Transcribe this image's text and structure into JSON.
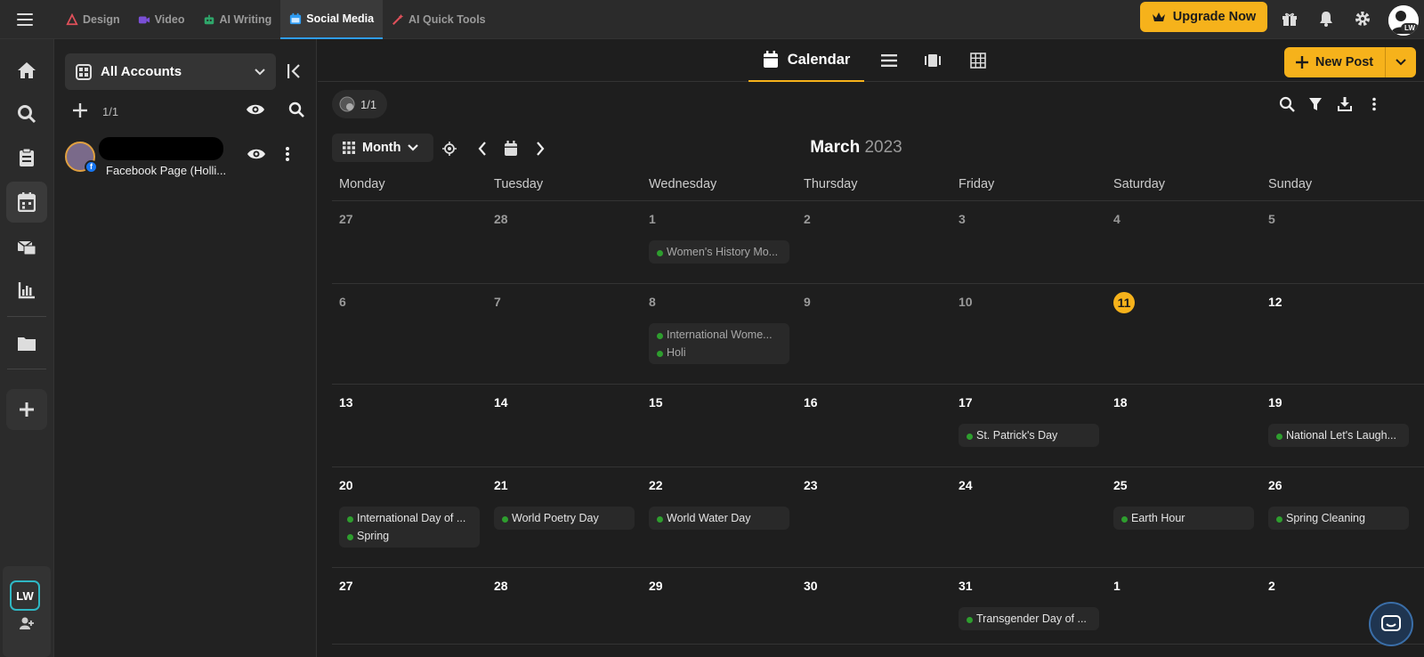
{
  "topbar": {
    "tabs": [
      {
        "label": "Design",
        "icon": "design-icon",
        "color": "#e0505a"
      },
      {
        "label": "Video",
        "icon": "video-icon",
        "color": "#7a4fd6"
      },
      {
        "label": "AI Writing",
        "icon": "robot-icon",
        "color": "#2fa66a"
      },
      {
        "label": "Social Media",
        "icon": "calendar-icon",
        "color": "#2f9df4"
      },
      {
        "label": "AI Quick Tools",
        "icon": "magic-wand-icon",
        "color": "#e0505a"
      }
    ],
    "upgrade_label": "Upgrade Now",
    "avatar_initials": "LW"
  },
  "rail": {
    "items": [
      "home-icon",
      "search-icon",
      "clipboard-icon",
      "calendar-icon",
      "inbox-icon",
      "analytics-icon",
      "folder-icon",
      "plus-icon"
    ],
    "workspace_initials": "LW"
  },
  "accounts": {
    "select_label": "All Accounts",
    "count": "1/1",
    "items": [
      {
        "name": "Facebook Page (Holli..."
      }
    ]
  },
  "main": {
    "view_label": "Calendar",
    "new_post_label": "New Post",
    "pages_count": "1/1",
    "view_mode": "Month",
    "month": "March",
    "year": "2023"
  },
  "calendar": {
    "weekdays": [
      "Monday",
      "Tuesday",
      "Wednesday",
      "Thursday",
      "Friday",
      "Saturday",
      "Sunday"
    ],
    "weeks": [
      [
        {
          "day": "27",
          "dim": true,
          "events": []
        },
        {
          "day": "28",
          "dim": true,
          "events": []
        },
        {
          "day": "1",
          "dim": true,
          "events": [
            "Women's History Mo..."
          ]
        },
        {
          "day": "2",
          "dim": true,
          "events": []
        },
        {
          "day": "3",
          "dim": true,
          "events": []
        },
        {
          "day": "4",
          "dim": true,
          "events": []
        },
        {
          "day": "5",
          "dim": true,
          "events": []
        }
      ],
      [
        {
          "day": "6",
          "dim": true,
          "events": []
        },
        {
          "day": "7",
          "dim": true,
          "events": []
        },
        {
          "day": "8",
          "dim": true,
          "events": [
            "International Wome...",
            "Holi"
          ]
        },
        {
          "day": "9",
          "dim": true,
          "events": []
        },
        {
          "day": "10",
          "dim": true,
          "events": []
        },
        {
          "day": "11",
          "today": true,
          "events": []
        },
        {
          "day": "12",
          "events": []
        }
      ],
      [
        {
          "day": "13",
          "events": []
        },
        {
          "day": "14",
          "events": []
        },
        {
          "day": "15",
          "events": []
        },
        {
          "day": "16",
          "events": []
        },
        {
          "day": "17",
          "events": [
            "St. Patrick's Day"
          ]
        },
        {
          "day": "18",
          "events": []
        },
        {
          "day": "19",
          "events": [
            "National Let's Laugh..."
          ]
        }
      ],
      [
        {
          "day": "20",
          "events": [
            "International Day of ...",
            "Spring"
          ]
        },
        {
          "day": "21",
          "events": [
            "World Poetry Day"
          ]
        },
        {
          "day": "22",
          "events": [
            "World Water Day"
          ]
        },
        {
          "day": "23",
          "events": []
        },
        {
          "day": "24",
          "events": []
        },
        {
          "day": "25",
          "events": [
            "Earth Hour"
          ]
        },
        {
          "day": "26",
          "events": [
            "Spring Cleaning"
          ]
        }
      ],
      [
        {
          "day": "27",
          "events": []
        },
        {
          "day": "28",
          "events": []
        },
        {
          "day": "29",
          "events": []
        },
        {
          "day": "30",
          "events": []
        },
        {
          "day": "31",
          "events": [
            "Transgender Day of ..."
          ]
        },
        {
          "day": "1",
          "events": []
        },
        {
          "day": "2",
          "events": []
        }
      ]
    ]
  },
  "colors": {
    "accent": "#f6b21b",
    "event_dot": "#2e9e2e",
    "active_tab": "#2f9df4"
  }
}
